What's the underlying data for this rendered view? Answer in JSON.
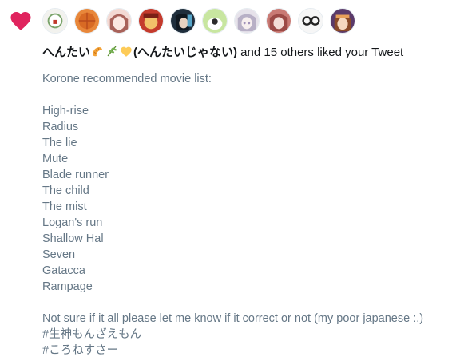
{
  "notification": {
    "heart_color": "#e0245e",
    "avatars": [
      {
        "icon": "avatar-1",
        "bg": "#f2f2ee",
        "accent": "#7aa36a"
      },
      {
        "icon": "avatar-2",
        "bg": "#e8873a",
        "accent": "#b84a1c"
      },
      {
        "icon": "avatar-3",
        "bg": "#f3d9d3",
        "accent": "#a8625a"
      },
      {
        "icon": "avatar-4",
        "bg": "#c43a2c",
        "accent": "#f2c16a"
      },
      {
        "icon": "avatar-5",
        "bg": "#1f2e3c",
        "accent": "#56a5c9"
      },
      {
        "icon": "avatar-6",
        "bg": "#c8e6a0",
        "accent": "#2b2b2b"
      },
      {
        "icon": "avatar-7",
        "bg": "#e6e2ea",
        "accent": "#a090b8"
      },
      {
        "icon": "avatar-8",
        "bg": "#c97a74",
        "accent": "#f3dcd6"
      },
      {
        "icon": "avatar-9",
        "bg": "#f6f6f6",
        "accent": "#222222"
      },
      {
        "icon": "avatar-10",
        "bg": "#5a3a6a",
        "accent": "#e8a05a"
      }
    ],
    "name_part1": "へんたい",
    "name_part2": "(へんたいじゃない)",
    "emoji_names": [
      "croissant-emoji",
      "herb-emoji",
      "yellow-heart-emoji"
    ],
    "rest": " and 15 others liked your Tweet"
  },
  "tweet": {
    "lines": [
      "Korone recommended movie list:",
      "",
      "High-rise",
      "Radius",
      "The lie",
      "Mute",
      "Blade runner",
      "The child",
      "The mist",
      "Logan's run",
      "Shallow Hal",
      "Seven",
      "Gatacca",
      "Rampage",
      "",
      "Not sure if it all please let me know if it correct or not (my poor japanese :,)",
      "#生神もんざえもん",
      "#ころねすさー"
    ]
  }
}
